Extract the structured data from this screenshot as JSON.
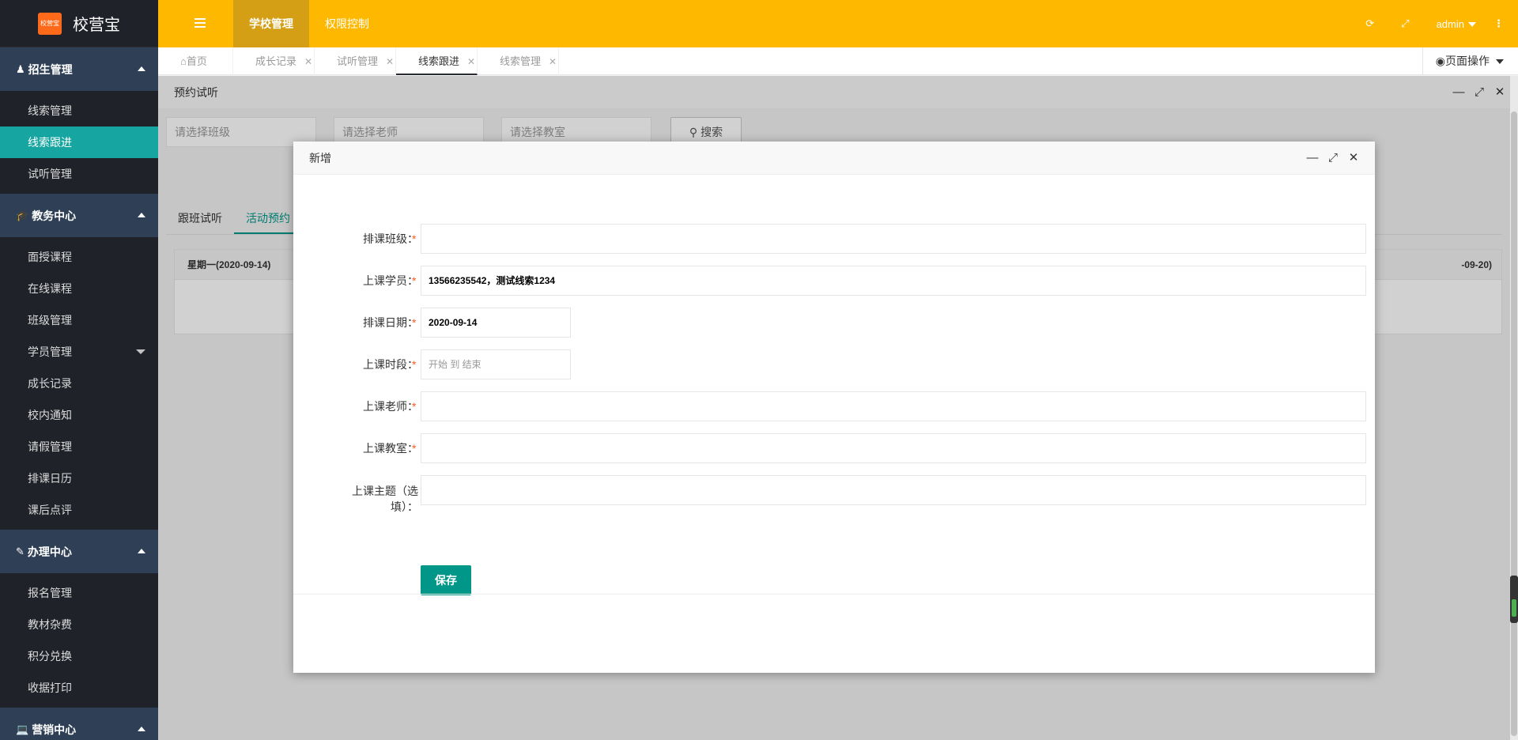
{
  "app": {
    "logo_text": "校营宝",
    "logo_mark": "校营宝"
  },
  "header": {
    "nav": [
      "学校管理",
      "权限控制"
    ],
    "user": "admin"
  },
  "tabs": [
    {
      "label": "首页"
    },
    {
      "label": "成长记录"
    },
    {
      "label": "试听管理"
    },
    {
      "label": "线索跟进"
    },
    {
      "label": "线索管理"
    }
  ],
  "page_ops": "页面操作",
  "sidebar": {
    "groups": [
      {
        "title": "招生管理",
        "items": [
          "线索管理",
          "线索跟进",
          "试听管理"
        ]
      },
      {
        "title": "教务中心",
        "items": [
          "面授课程",
          "在线课程",
          "班级管理",
          "学员管理",
          "成长记录",
          "校内通知",
          "请假管理",
          "排课日历",
          "课后点评"
        ]
      },
      {
        "title": "办理中心",
        "items": [
          "报名管理",
          "教材杂费",
          "积分兑换",
          "收据打印"
        ]
      },
      {
        "title": "营销中心",
        "items": []
      }
    ]
  },
  "content": {
    "layer_title": "预约试听",
    "filters": {
      "class": "请选择班级",
      "teacher": "请选择老师",
      "room": "请选择教室",
      "search": "搜索"
    },
    "sub_tabs": [
      "跟班试听",
      "活动预约"
    ],
    "cal_first": "星期一(2020-09-14)",
    "cal_last": "-09-20)"
  },
  "modal": {
    "title": "新增",
    "fields": [
      {
        "label": "排课班级：",
        "required": "*",
        "value": ""
      },
      {
        "label": "上课学员：",
        "required": "*",
        "value": "13566235542，测试线索1234"
      },
      {
        "label": "排课日期：",
        "required": "*",
        "value": "2020-09-14"
      },
      {
        "label": "上课时段：",
        "required": "*",
        "placeholder": "开始 到 结束"
      },
      {
        "label": "上课老师：",
        "required": "*",
        "value": ""
      },
      {
        "label": "上课教室：",
        "required": "*",
        "value": ""
      },
      {
        "label_line1": "上课主题（选",
        "label_line2": "填）：",
        "value": ""
      }
    ],
    "save": "保存"
  },
  "colors": {
    "header": "#ffb800",
    "sidebar": "#20222a",
    "group": "#2f4056",
    "active": "#16a5a0",
    "primary": "#009688"
  }
}
